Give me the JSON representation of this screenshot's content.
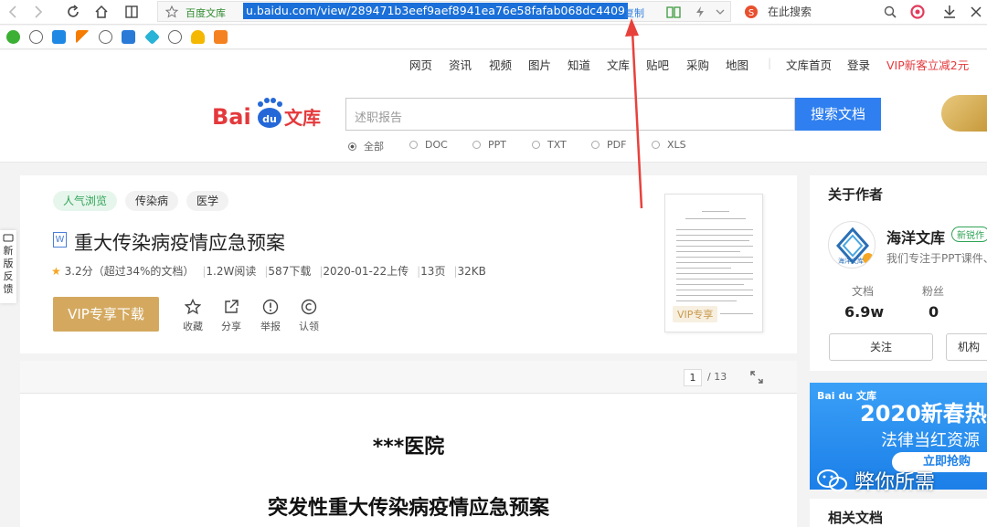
{
  "browser": {
    "site_label": "百度文库",
    "url": "u.baidu.com/view/289471b3eef9aef8941ea76e58fafab068dc4409",
    "copy_label": "复制",
    "search_here": "在此搜索"
  },
  "topnav": {
    "items": [
      "网页",
      "资讯",
      "视频",
      "图片",
      "知道",
      "文库",
      "贴吧",
      "采购",
      "地图"
    ],
    "home": "文库首页",
    "login": "登录",
    "vip": "VIP新客立减2元"
  },
  "search": {
    "placeholder": "述职报告",
    "button": "搜索文档",
    "filters": [
      "全部",
      "DOC",
      "PPT",
      "TXT",
      "PDF",
      "XLS"
    ],
    "selected": "全部"
  },
  "feedback": "新版反馈",
  "doc": {
    "tags": [
      "人气浏览",
      "传染病",
      "医学"
    ],
    "icon_letter": "W",
    "title": "重大传染病疫情应急预案",
    "rating": "3.2分",
    "rating_note": "（超过34%的文档）",
    "reads": "1.2W阅读",
    "downloads": "587下载",
    "date": "2020-01-22上传",
    "pages": "13页",
    "size": "32KB",
    "download_button": "VIP专享下载",
    "actions": [
      "收藏",
      "分享",
      "举报",
      "认领"
    ],
    "thumb_badge": "VIP专享"
  },
  "reader": {
    "page": "1",
    "total": "/ 13",
    "hospital": "***医院",
    "plan_title": "突发性重大传染病疫情应急预案"
  },
  "author": {
    "heading": "关于作者",
    "name": "海洋文库",
    "badge": "新锐作",
    "desc": "我们专注于PPT课件、",
    "avatar_text": "海洋文库",
    "stats": [
      {
        "label": "文档",
        "value": "6.9w"
      },
      {
        "label": "粉丝",
        "value": "0"
      }
    ],
    "follow": "关注",
    "org": "机构"
  },
  "promo": {
    "logo": "Bai du 文库",
    "title": "2020新春热",
    "subtitle": "法律当红资源",
    "button": "立即抢购"
  },
  "related": {
    "heading": "相关文档"
  },
  "watermark": "弊你所需",
  "colors": {
    "accent": "#2f7ff0",
    "vip_gold": "#d4a95f",
    "annotation": "#e8413c",
    "url_highlight": "#1a6fd9"
  }
}
